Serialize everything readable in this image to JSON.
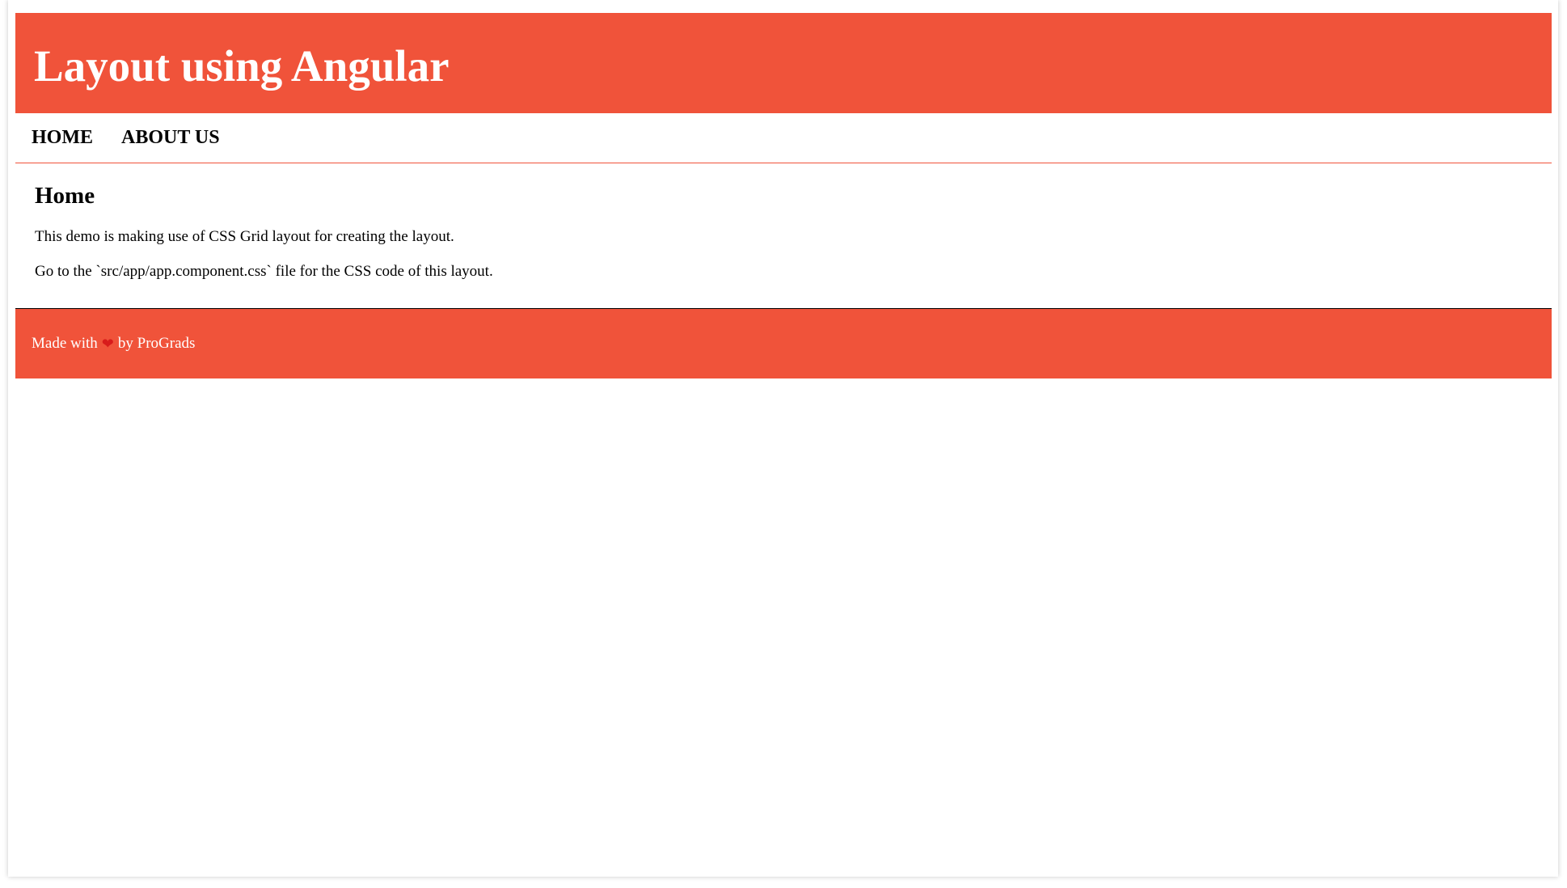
{
  "header": {
    "title": "Layout using Angular",
    "background_color": "#f0533a"
  },
  "nav": {
    "items": [
      {
        "label": "HOME"
      },
      {
        "label": "ABOUT US"
      }
    ]
  },
  "main": {
    "heading": "Home",
    "paragraphs": [
      "This demo is making use of CSS Grid layout for creating the layout.",
      "Go to the `src/app/app.component.css` file for the CSS code of this layout."
    ]
  },
  "footer": {
    "prefix": "Made with",
    "icon": "heart-icon",
    "suffix": "by ProGrads"
  }
}
